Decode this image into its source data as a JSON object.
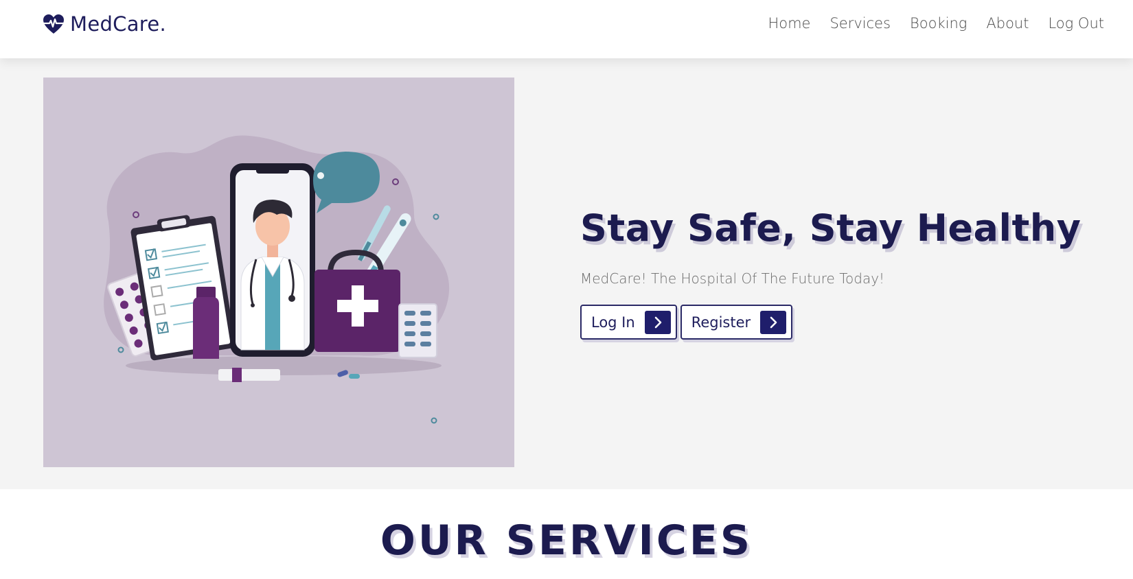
{
  "header": {
    "logo_text": "MedCare.",
    "logo_icon": "heart-pulse-icon",
    "nav": [
      {
        "label": "Home"
      },
      {
        "label": "Services"
      },
      {
        "label": "Booking"
      },
      {
        "label": "About"
      },
      {
        "label": "Log Out"
      }
    ]
  },
  "hero": {
    "title": "Stay Safe, Stay Healthy",
    "subtitle": "MedCare! The Hospital Of The Future Today!",
    "buttons": [
      {
        "label": "Log In",
        "icon": "chevron-right-icon"
      },
      {
        "label": "Register",
        "icon": "chevron-right-icon"
      }
    ],
    "illustration": "doctor-on-phone-with-medical-kit-illustration"
  },
  "services": {
    "title": "OUR SERVICES"
  },
  "colors": {
    "brand_navy": "#1c1b4f",
    "button_accent": "#1f1e6b",
    "hero_image_bg": "#cec5d4",
    "illustration_purple": "#5b2468",
    "illustration_teal": "#4d8a9c"
  }
}
